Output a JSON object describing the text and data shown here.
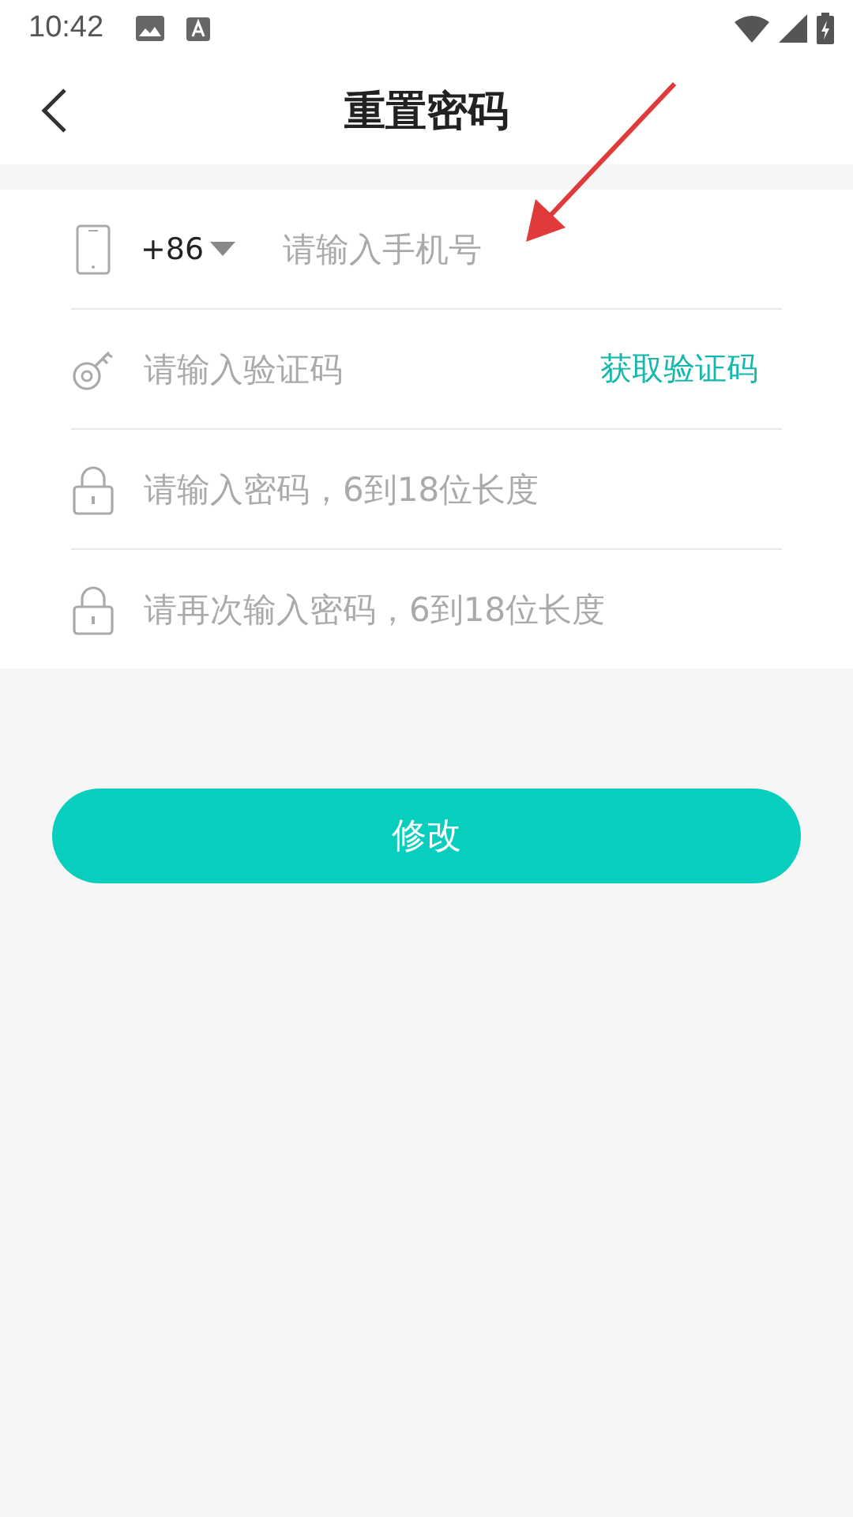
{
  "status_bar": {
    "time": "10:42"
  },
  "header": {
    "title": "重置密码"
  },
  "fields": [
    {
      "kind": "phone",
      "prefix": "+86",
      "placeholder": "请输入手机号"
    },
    {
      "kind": "code",
      "placeholder": "请输入验证码",
      "action": "获取验证码"
    },
    {
      "kind": "password",
      "placeholder": "请输入密码，6到18位长度"
    },
    {
      "kind": "password",
      "placeholder": "请再次输入密码，6到18位长度"
    }
  ],
  "submit_button": "修改"
}
